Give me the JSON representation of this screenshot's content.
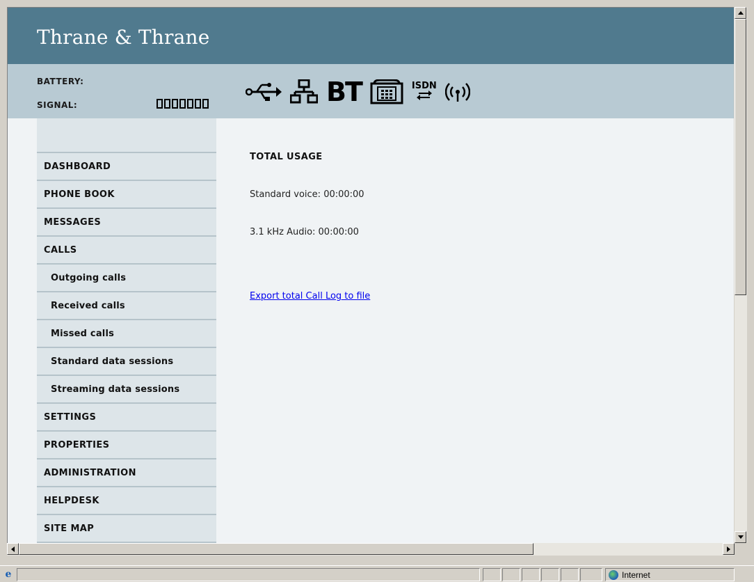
{
  "header": {
    "brand": "Thrane & Thrane",
    "battery_label": "BATTERY:",
    "signal_label": "SIGNAL:",
    "interface_icons": [
      "usb-icon",
      "lan-icon",
      "bluetooth-icon",
      "phone-icon",
      "isdn-icon",
      "wlan-icon"
    ],
    "bt_text": "BT",
    "isdn_text": "ISDN"
  },
  "sidebar": {
    "items": [
      {
        "label": "DASHBOARD"
      },
      {
        "label": "PHONE BOOK"
      },
      {
        "label": "MESSAGES"
      },
      {
        "label": "CALLS"
      },
      {
        "label": "Outgoing calls"
      },
      {
        "label": "Received calls"
      },
      {
        "label": "Missed calls"
      },
      {
        "label": "Standard data sessions"
      },
      {
        "label": "Streaming data sessions"
      },
      {
        "label": "SETTINGS"
      },
      {
        "label": "PROPERTIES"
      },
      {
        "label": "ADMINISTRATION"
      },
      {
        "label": "HELPDESK"
      },
      {
        "label": "SITE MAP"
      }
    ]
  },
  "main": {
    "title": "TOTAL USAGE",
    "standard_voice": "Standard voice: 00:00:00",
    "audio": "3.1 kHz Audio: 00:00:00",
    "export_link": "Export total Call Log to file"
  },
  "browser_status": {
    "zone": "Internet"
  },
  "colors": {
    "banner": "#507a8e",
    "status_bar": "#b8cad3",
    "sidebar": "#dde5e9",
    "content_bg": "#f0f3f5",
    "link": "#0000ee"
  }
}
